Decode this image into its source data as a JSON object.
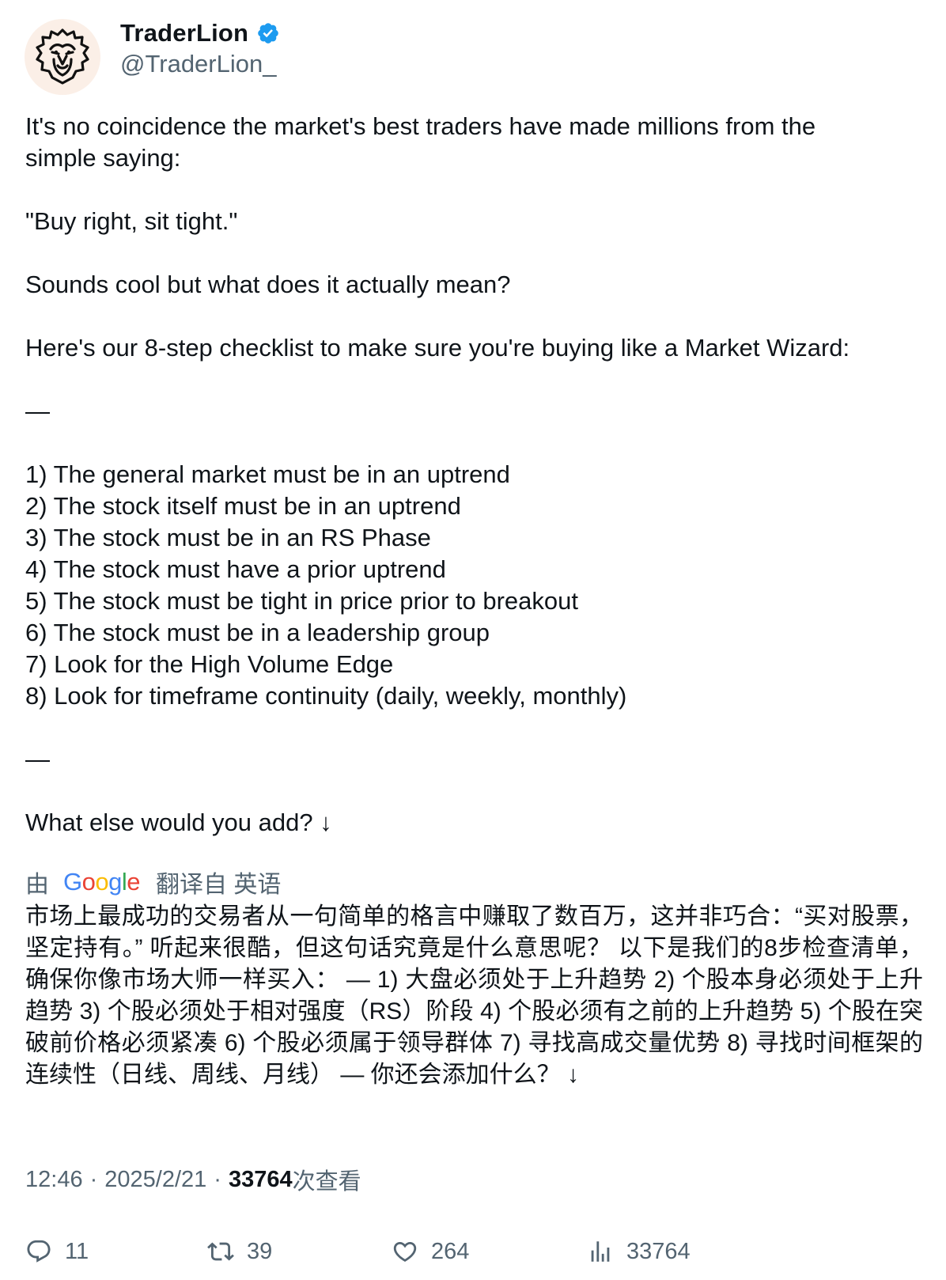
{
  "author": {
    "display_name": "TraderLion",
    "handle": "@TraderLion_",
    "verified": true,
    "avatar_icon": "lion-logo-icon",
    "verified_icon": "verified-badge-icon",
    "verified_color": "#1d9bf0"
  },
  "tweet": {
    "lines": [
      "It's no coincidence the market's best traders have made millions from the",
      "simple saying:",
      "",
      "\"Buy right, sit tight.\"",
      "",
      "Sounds cool but what does it actually mean?",
      "",
      "Here's our 8-step checklist to make sure you're buying like a Market Wizard:",
      "",
      "—",
      "",
      "1) The general market must be in an uptrend",
      "2) The stock itself must be in an uptrend",
      "3) The stock must be in an RS Phase",
      "4) The stock must have a prior uptrend",
      "5) The stock must be tight in price prior to breakout",
      "6) The stock must be in a leadership group",
      "7) Look for the High Volume Edge",
      "8) Look for timeframe continuity (daily, weekly, monthly)",
      "",
      "—",
      "",
      "What else would you add? ↓"
    ]
  },
  "translation": {
    "by_label": "由",
    "logo_text": "Google",
    "from_label": "翻译自 英语",
    "text": "市场上最成功的交易者从一句简单的格言中赚取了数百万，这并非巧合：“买对股票，坚定持有。” 听起来很酷，但这句话究竟是什么意思呢？ 以下是我们的8步检查清单，确保你像市场大师一样买入： — 1) 大盘必须处于上升趋势 2) 个股本身必须处于上升趋势 3) 个股必须处于相对强度（RS）阶段 4) 个股必须有之前的上升趋势 5) 个股在突破前价格必须紧凑 6) 个股必须属于领导群体 7) 寻找高成交量优势 8) 寻找时间框架的连续性（日线、周线、月线） — 你还会添加什么？ ↓"
  },
  "meta": {
    "time": "12:46",
    "separator": "·",
    "date": "2025/2/21",
    "views_count": "33764",
    "views_label": "次查看"
  },
  "actions": {
    "replies": "11",
    "retweets": "39",
    "likes": "264",
    "views": "33764",
    "icons": [
      "reply-icon",
      "retweet-icon",
      "like-icon",
      "views-icon"
    ]
  }
}
